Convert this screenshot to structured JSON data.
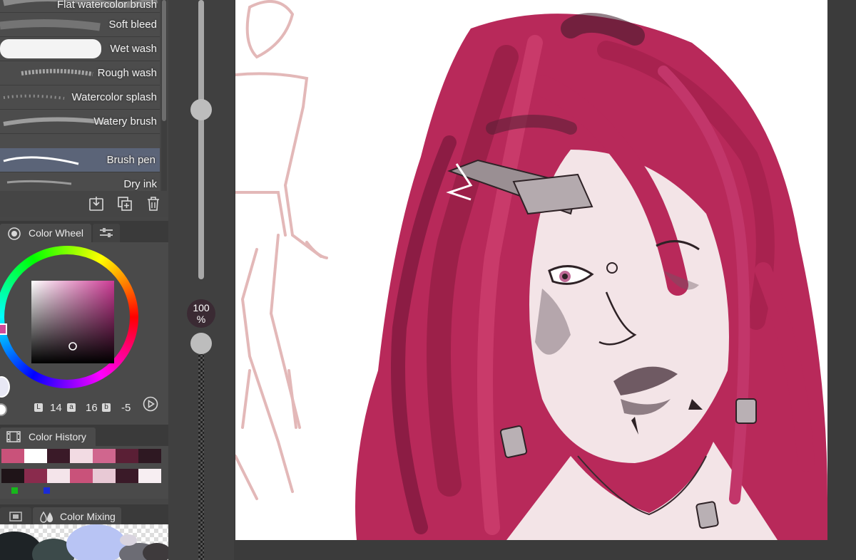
{
  "brushes": [
    {
      "label": "Flat watercolor brush"
    },
    {
      "label": "Soft bleed"
    },
    {
      "label": "Wet wash"
    },
    {
      "label": "Rough wash"
    },
    {
      "label": "Watercolor splash"
    },
    {
      "label": "Watery brush"
    },
    {
      "label": "Brush pen",
      "selected": true
    },
    {
      "label": "Dry ink"
    }
  ],
  "brush_actions": {
    "icons": [
      "import-icon",
      "duplicate-icon",
      "trash-icon"
    ]
  },
  "color_wheel": {
    "tab_label": "Color Wheel",
    "L": "14",
    "a": "16",
    "b": "-5",
    "badges": {
      "L": "L",
      "a": "a",
      "b": "b"
    },
    "selected_color": "#c93a8e"
  },
  "color_history": {
    "tab_label": "Color History",
    "swatches": [
      "#c9527a",
      "#ffffff",
      "#3a1a28",
      "#f2dbe3",
      "#d0668e",
      "#5a1f35",
      "#2e1822",
      "#1f1418",
      "#8a2b4d",
      "#f4e4ea",
      "#c9527a",
      "#e8c9d5",
      "#3a1a28",
      "#f7eef2"
    ]
  },
  "color_mixing": {
    "tab_label": "Color Mixing"
  },
  "opacity": {
    "value": "100",
    "unit": "%",
    "level": 1.0
  },
  "colors": {
    "hair": "#b8295a",
    "hair_dark": "#7a1838",
    "skin": "#f3e4e7",
    "sketch": "#e3b8b8",
    "panel": "#4a4a4a"
  }
}
